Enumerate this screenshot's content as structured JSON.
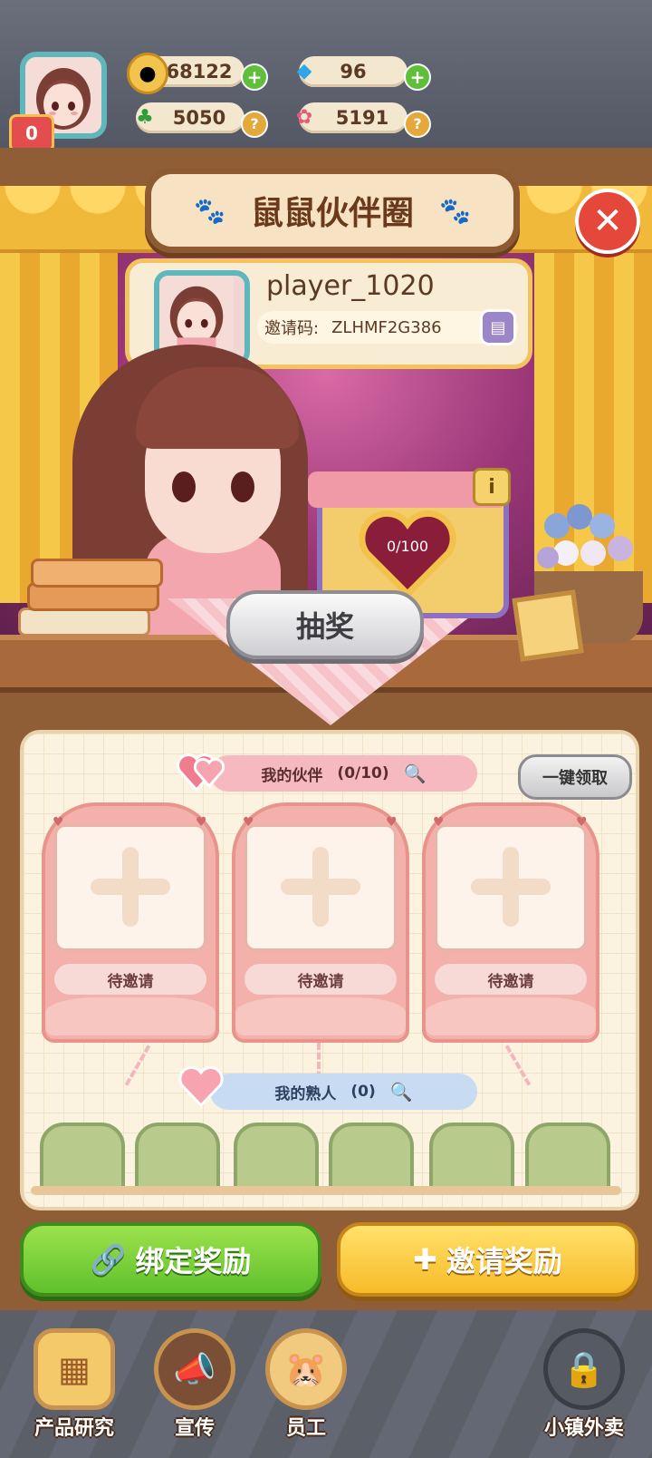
{
  "resources": {
    "coins": "68122",
    "gems": "96",
    "clover": "5050",
    "flower": "5191",
    "level": "0"
  },
  "panel": {
    "title": "鼠鼠伙伴圈"
  },
  "player": {
    "name": "player_1020",
    "invite_label": "邀请码:",
    "invite_code": "ZLHMF2G386"
  },
  "lottery": {
    "progress": "0/100",
    "draw_label": "抽奖",
    "info_label": "i"
  },
  "partners": {
    "header_label": "我的伙伴",
    "header_count": "(0/10)",
    "claim_all_label": "一键领取",
    "slots": [
      {
        "label": "待邀请"
      },
      {
        "label": "待邀请"
      },
      {
        "label": "待邀请"
      }
    ]
  },
  "acquaintances": {
    "header_label": "我的熟人",
    "header_count": "(0)"
  },
  "actions": {
    "bind_label": "绑定奖励",
    "invite_label": "邀请奖励"
  },
  "nav": {
    "items": [
      {
        "label": "产品研究",
        "icon": "research-icon"
      },
      {
        "label": "宣传",
        "icon": "megaphone-icon"
      },
      {
        "label": "员工",
        "icon": "hamster-icon"
      },
      {
        "label": "小镇外卖",
        "icon": "delivery-icon"
      }
    ]
  },
  "colors": {
    "accent_green": "#5fc12b",
    "accent_yellow": "#f7bb28",
    "close_red": "#e5483a",
    "partner_pink": "#f6b9c0",
    "acquaintance_blue": "#c7dbf3"
  }
}
